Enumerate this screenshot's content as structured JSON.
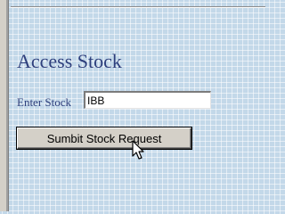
{
  "page": {
    "title": "Access Stock"
  },
  "form": {
    "stock_label": "Enter Stock",
    "stock_value": "IBB",
    "submit_label": "Sumbit Stock Request"
  },
  "icons": {
    "cursor": "mouse-pointer-icon"
  },
  "colors": {
    "background": "#c3d8e9",
    "heading_text": "#2e3f7c",
    "button_face": "#d4d0c8"
  }
}
